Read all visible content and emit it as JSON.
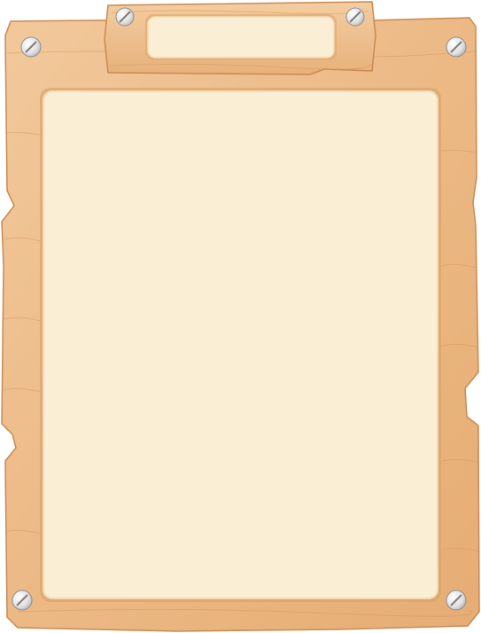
{
  "board": {
    "title": "",
    "content": ""
  },
  "colors": {
    "wood_light": "#f0c595",
    "wood_mid": "#e9b27c",
    "wood_dark": "#c98b52",
    "wood_edge": "#b97a44",
    "paper": "#faeed5",
    "paper_border": "#f3dcb4",
    "screw": "#d9d9d9"
  },
  "icons": {
    "corner_screws": "screw-icon",
    "plaque_screws": "screw-icon"
  }
}
